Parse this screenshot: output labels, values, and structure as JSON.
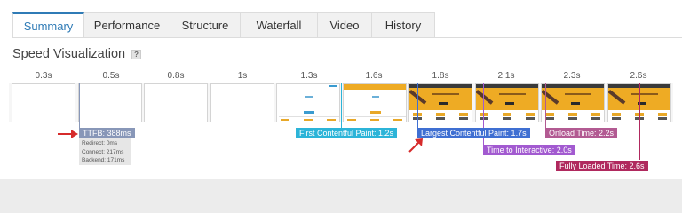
{
  "tabs": [
    "Summary",
    "Performance",
    "Structure",
    "Waterfall",
    "Video",
    "History"
  ],
  "section_title": "Speed Visualization",
  "help_badge": "?",
  "timeline": {
    "times": [
      "0.3s",
      "0.5s",
      "0.8s",
      "1s",
      "1.3s",
      "1.6s",
      "1.8s",
      "2.1s",
      "2.3s",
      "2.6s"
    ]
  },
  "markers": {
    "ttfb": "TTFB: 388ms",
    "ttfb_details": [
      "Redirect: 0ms",
      "Connect: 217ms",
      "Backend: 171ms"
    ],
    "fcp": "First Contentful Paint: 1.2s",
    "lcp": "Largest Contentful Paint: 1.7s",
    "tti": "Time to Interactive: 2.0s",
    "onload": "Onload Time: 2.2s",
    "fully_loaded": "Fully Loaded Time: 2.6s"
  },
  "colors": {
    "accent": "#2f7bb6",
    "ttfb": "#8897b8",
    "fcp": "#2cb4d8",
    "lcp": "#3f6fd2",
    "tti": "#a25ad0",
    "onload": "#b25a92",
    "fully_loaded": "#b0295e",
    "annotation_arrow": "#d62b2b"
  }
}
